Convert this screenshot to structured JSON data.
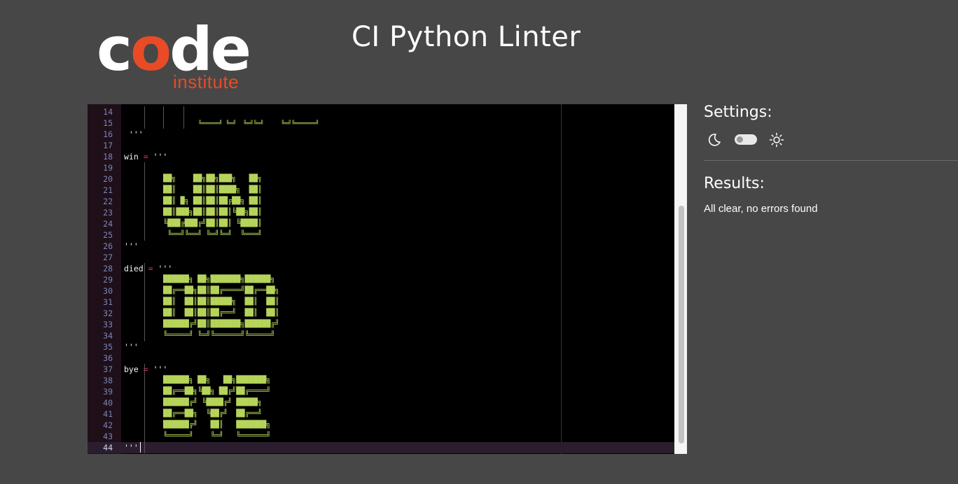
{
  "logo": {
    "word_c": "c",
    "word_o": "o",
    "word_de": "de",
    "sub": "institute"
  },
  "title": "CI Python Linter",
  "editor": {
    "lines": [
      {
        "n": "14",
        "text": ""
      },
      {
        "n": "15",
        "text": ""
      },
      {
        "n": "16",
        "text": " '''"
      },
      {
        "n": "17",
        "text": ""
      },
      {
        "n": "18",
        "text": "win",
        "op": " = ",
        "rest": "'''"
      },
      {
        "n": "19",
        "text": ""
      },
      {
        "n": "20",
        "text": ""
      },
      {
        "n": "21",
        "text": ""
      },
      {
        "n": "22",
        "text": ""
      },
      {
        "n": "23",
        "text": ""
      },
      {
        "n": "24",
        "text": ""
      },
      {
        "n": "25",
        "text": ""
      },
      {
        "n": "26",
        "text": "'''"
      },
      {
        "n": "27",
        "text": ""
      },
      {
        "n": "28",
        "text": "died",
        "op": " = ",
        "rest": "'''"
      },
      {
        "n": "29",
        "text": ""
      },
      {
        "n": "30",
        "text": ""
      },
      {
        "n": "31",
        "text": ""
      },
      {
        "n": "32",
        "text": ""
      },
      {
        "n": "33",
        "text": ""
      },
      {
        "n": "34",
        "text": ""
      },
      {
        "n": "35",
        "text": "'''"
      },
      {
        "n": "36",
        "text": ""
      },
      {
        "n": "37",
        "text": "bye",
        "op": " = ",
        "rest": "'''"
      },
      {
        "n": "38",
        "text": ""
      },
      {
        "n": "39",
        "text": ""
      },
      {
        "n": "40",
        "text": ""
      },
      {
        "n": "41",
        "text": ""
      },
      {
        "n": "42",
        "text": ""
      },
      {
        "n": "43",
        "text": ""
      },
      {
        "n": "44",
        "text": "'''"
      }
    ],
    "art": {
      "game": [
        "╚═════╝ ╚═╝  ╚═╝╚═╝     ╚═╝╚══════╝"
      ],
      "win": [
        "██╗    ██╗██╗███╗   ██╗",
        "██║    ██║██║████╗  ██║",
        "██║ █╗ ██║██║██╔██╗ ██║",
        "██║███╗██║██║██║╚██╗██║",
        "╚███╔███╔╝██║██║ ╚████║",
        " ╚══╝╚══╝ ╚═╝╚═╝  ╚═══╝"
      ],
      "died": [
        "██████╗ ██╗███████╗██████╗",
        "██╔══██╗██║██╔════╝██╔══██╗",
        "██║  ██║██║█████╗  ██║  ██║",
        "██║  ██║██║██╔══╝  ██║  ██║",
        "██████╔╝██║███████╗██████╔╝",
        "╚═════╝ ╚═╝╚══════╝╚═════╝"
      ],
      "bye": [
        "██████╗ ██╗   ██╗███████╗",
        "██╔══██╗╚██╗ ██╔╝██╔════╝",
        "██████╔╝ ╚████╔╝ █████╗",
        "██╔══██╗  ╚██╔╝  ██╔══╝",
        "██████╔╝   ██║   ███████╗",
        "╚═════╝    ╚═╝   ╚══════╝"
      ]
    }
  },
  "settings": {
    "title": "Settings:",
    "theme": "dark-toggle-off"
  },
  "results": {
    "title": "Results:",
    "message": "All clear, no errors found"
  },
  "colors": {
    "bg": "#474747",
    "accent": "#e84b26",
    "art": "#b6d45a",
    "operator": "#f92672"
  }
}
